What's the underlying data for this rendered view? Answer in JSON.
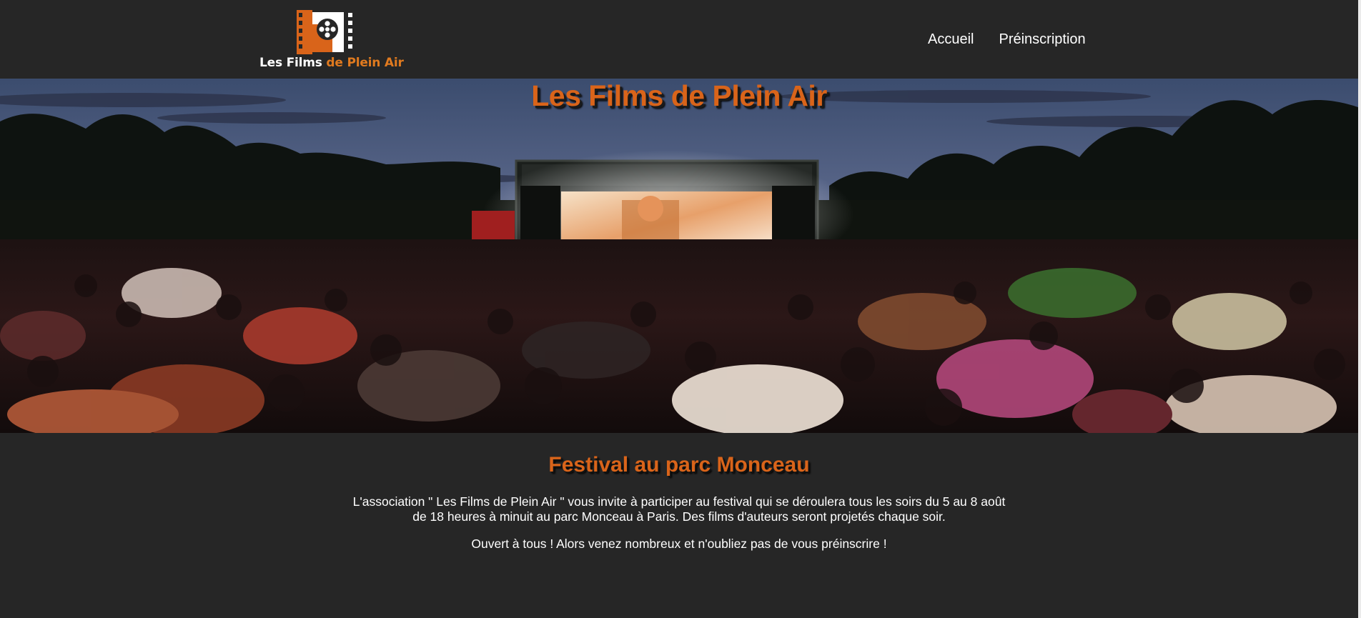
{
  "header": {
    "logo": {
      "text_part1": "Les Films",
      "text_part2": "de Plein Air",
      "icon": "film-reel-icon"
    },
    "nav": [
      {
        "label": "Accueil"
      },
      {
        "label": "Préinscription"
      }
    ]
  },
  "hero": {
    "title": "Les Films de Plein Air"
  },
  "main": {
    "heading": "Festival au parc Monceau",
    "paragraph": "L'association \" Les Films de Plein Air \" vous invite à participer au festival qui se déroulera tous les soirs du 5 au 8 août de 18 heures à minuit au parc Monceau à Paris. Des films d'auteurs seront projetés chaque soir.",
    "cta": "Ouvert à tous ! Alors venez nombreux et n'oubliez pas de vous préinscrire !"
  },
  "colors": {
    "background": "#262626",
    "accent": "#d9641a",
    "text": "#ffffff"
  }
}
